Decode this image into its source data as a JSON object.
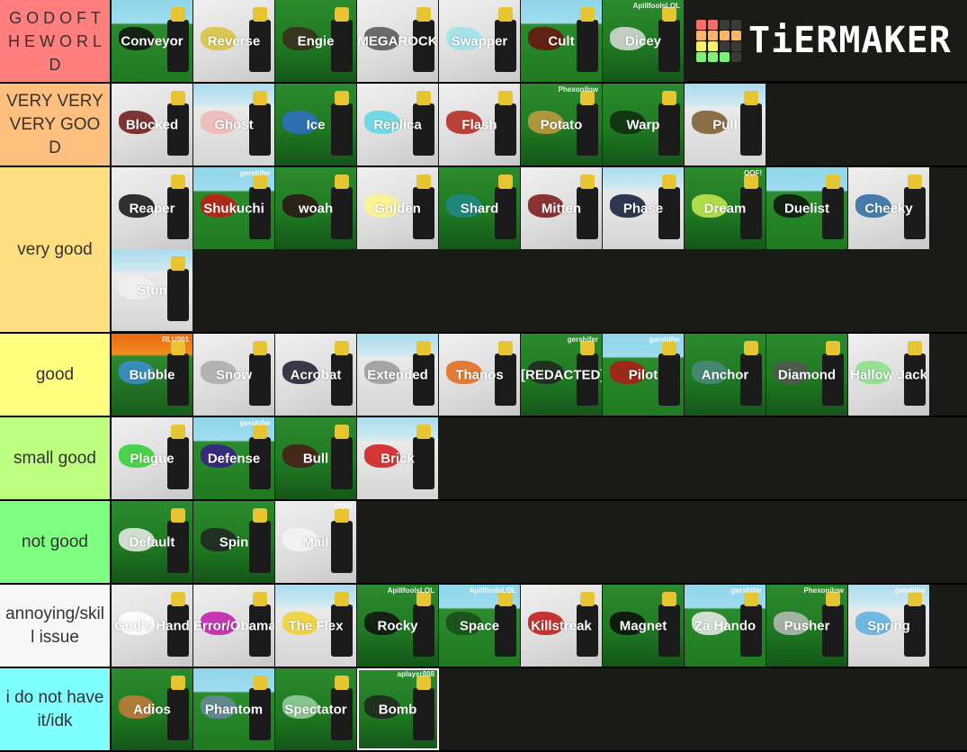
{
  "app": {
    "brand": "TiERMAKER"
  },
  "logo": {
    "grid": [
      [
        "#f76d6d",
        "#f76d6d",
        "#3a3a3a",
        "#3a3a3a"
      ],
      [
        "#f9b46e",
        "#f9b46e",
        "#f9b46e",
        "#f9b46e"
      ],
      [
        "#f4f06a",
        "#f4f06a",
        "#3a3a3a",
        "#3a3a3a"
      ],
      [
        "#7ef07a",
        "#7ef07a",
        "#7ef07a",
        "#3a3a3a"
      ]
    ]
  },
  "tiers": [
    {
      "label": "G O D O F T H E W O R L D",
      "color": "#ff7f7f",
      "items": [
        {
          "name": "Conveyor",
          "bg": "bg-sky",
          "glove": "#111"
        },
        {
          "name": "Reverse",
          "bg": "bg-snow",
          "glove": "#d9c23a"
        },
        {
          "name": "Engie",
          "bg": "bg-grass",
          "glove": "#3a2a1e"
        },
        {
          "name": "MEGAROCK",
          "bg": "bg-snow",
          "glove": "#555"
        },
        {
          "name": "Swapper",
          "bg": "bg-snow",
          "glove": "#9be3ea"
        },
        {
          "name": "Cult",
          "bg": "bg-sky",
          "glove": "#6a1010"
        },
        {
          "name": "Dicey",
          "bg": "bg-grass",
          "glove": "#ddd",
          "tag": "ApillfoolsLOL"
        }
      ]
    },
    {
      "label": "VERY VERY VERY GOOD",
      "color": "#ffbf7f",
      "items": [
        {
          "name": "Blocked",
          "bg": "bg-snow",
          "glove": "#6e1414"
        },
        {
          "name": "Ghost",
          "bg": "bg-skysnow",
          "glove": "#f2b6b6"
        },
        {
          "name": "Ice",
          "bg": "bg-grass",
          "glove": "#2f6fc9"
        },
        {
          "name": "Replica",
          "bg": "bg-snow",
          "glove": "#5ed6e0"
        },
        {
          "name": "Flash",
          "bg": "bg-snow",
          "glove": "#b3251c"
        },
        {
          "name": "Potato",
          "bg": "bg-grass",
          "glove": "#c79a3e",
          "tag": "Phexonilow"
        },
        {
          "name": "Warp",
          "bg": "bg-grass",
          "glove": "#0f2a10"
        },
        {
          "name": "Pull",
          "bg": "bg-skysnow",
          "glove": "#7a5a2a"
        }
      ]
    },
    {
      "label": "very good",
      "color": "#ffdf7f",
      "items": [
        {
          "name": "Reaper",
          "bg": "bg-snow",
          "glove": "#111"
        },
        {
          "name": "Shukuchi",
          "bg": "bg-sky",
          "glove": "#c81818",
          "tag": "gershifer"
        },
        {
          "name": "woah",
          "bg": "bg-grass",
          "glove": "#2a1414"
        },
        {
          "name": "Golden",
          "bg": "bg-snow",
          "glove": "#fff58a"
        },
        {
          "name": "Shard",
          "bg": "bg-grass",
          "glove": "#1f8a8a"
        },
        {
          "name": "Mitten",
          "bg": "bg-snow",
          "glove": "#7a1414"
        },
        {
          "name": "Phase",
          "bg": "bg-skysnow",
          "glove": "#0c1a33"
        },
        {
          "name": "Dream",
          "bg": "bg-grass",
          "glove": "#c8ec50",
          "tag": "OOF!"
        },
        {
          "name": "Duelist",
          "bg": "bg-sky",
          "glove": "#111"
        },
        {
          "name": "Cheeky",
          "bg": "bg-snow",
          "glove": "#2a6aa0"
        },
        {
          "name": "Stun",
          "bg": "bg-skysnow",
          "glove": "#f0f0f0"
        }
      ]
    },
    {
      "label": "good",
      "color": "#ffff7f",
      "items": [
        {
          "name": "Bubble",
          "bg": "bg-lava",
          "glove": "#3a8fd0",
          "tag": "RLU001"
        },
        {
          "name": "Snow",
          "bg": "bg-snow",
          "glove": "#aaa"
        },
        {
          "name": "Acrobat",
          "bg": "bg-snow",
          "glove": "#1a1a2a"
        },
        {
          "name": "Extended",
          "bg": "bg-skysnow",
          "glove": "#999"
        },
        {
          "name": "Thanos",
          "bg": "bg-snow",
          "glove": "#e06a1a"
        },
        {
          "name": "[REDACTED]",
          "bg": "bg-grass",
          "glove": "#222",
          "tag": "gershifer"
        },
        {
          "name": "Pilot",
          "bg": "bg-sky",
          "glove": "#b01818",
          "tag": "gershifer"
        },
        {
          "name": "Anchor",
          "bg": "bg-grass",
          "glove": "#4a8a80"
        },
        {
          "name": "Diamond",
          "bg": "bg-grass",
          "glove": "#555"
        },
        {
          "name": "Hallow Jack",
          "bg": "bg-snow",
          "glove": "#8ae08a"
        }
      ]
    },
    {
      "label": "small good",
      "color": "#bfff7f",
      "items": [
        {
          "name": "Plague",
          "bg": "bg-snow",
          "glove": "#2fd02f"
        },
        {
          "name": "Defense",
          "bg": "bg-sky",
          "glove": "#3a1a8a",
          "tag": "gershifer"
        },
        {
          "name": "Bull",
          "bg": "bg-grass",
          "glove": "#4a1a1a"
        },
        {
          "name": "Brick",
          "bg": "bg-skysnow",
          "glove": "#d01818"
        }
      ]
    },
    {
      "label": "not good",
      "color": "#7fff7f",
      "items": [
        {
          "name": "Default",
          "bg": "bg-grass",
          "glove": "#eee"
        },
        {
          "name": "Spin",
          "bg": "bg-grass",
          "glove": "#222"
        },
        {
          "name": "Mail",
          "bg": "bg-snow",
          "glove": "#f4f4f4",
          "tag": "OOF!"
        }
      ]
    },
    {
      "label": "annoying/skill issue",
      "color": "#f7f7f7",
      "items": [
        {
          "name": "God's Hand",
          "bg": "bg-snow",
          "glove": "#fff"
        },
        {
          "name": "Error/Obama",
          "bg": "bg-snow",
          "glove": "#c01aa8"
        },
        {
          "name": "The Flex",
          "bg": "bg-skysnow",
          "glove": "#f0d030"
        },
        {
          "name": "Rocky",
          "bg": "bg-grass",
          "glove": "#111",
          "tag": "ApillfoolsLOL"
        },
        {
          "name": "Space",
          "bg": "bg-sky",
          "glove": "#1a4a1a",
          "tag": "ApillfoolsLOL"
        },
        {
          "name": "Killstreak",
          "bg": "bg-snow",
          "glove": "#c01414"
        },
        {
          "name": "Magnet",
          "bg": "bg-grass",
          "glove": "#0a0a0a"
        },
        {
          "name": "Za Hando",
          "bg": "bg-sky",
          "glove": "#eee",
          "tag": "gershifer"
        },
        {
          "name": "Pusher",
          "bg": "bg-grass",
          "glove": "#bbb",
          "tag": "Phexonilow"
        },
        {
          "name": "Spring",
          "bg": "bg-skysnow",
          "glove": "#5ab0e0",
          "tag": "gershifer"
        }
      ]
    },
    {
      "label": "i do not have it/idk",
      "color": "#7fffff",
      "items": [
        {
          "name": "Adios",
          "bg": "bg-grass",
          "glove": "#c87a3a"
        },
        {
          "name": "Phantom",
          "bg": "bg-sky",
          "glove": "#6a8aa0"
        },
        {
          "name": "Spectator",
          "bg": "bg-grass",
          "glove": "#9ad0a0"
        },
        {
          "name": "Bomb",
          "bg": "bg-grass",
          "glove": "#222",
          "tag": "aplayer888",
          "framed": true
        }
      ]
    }
  ]
}
